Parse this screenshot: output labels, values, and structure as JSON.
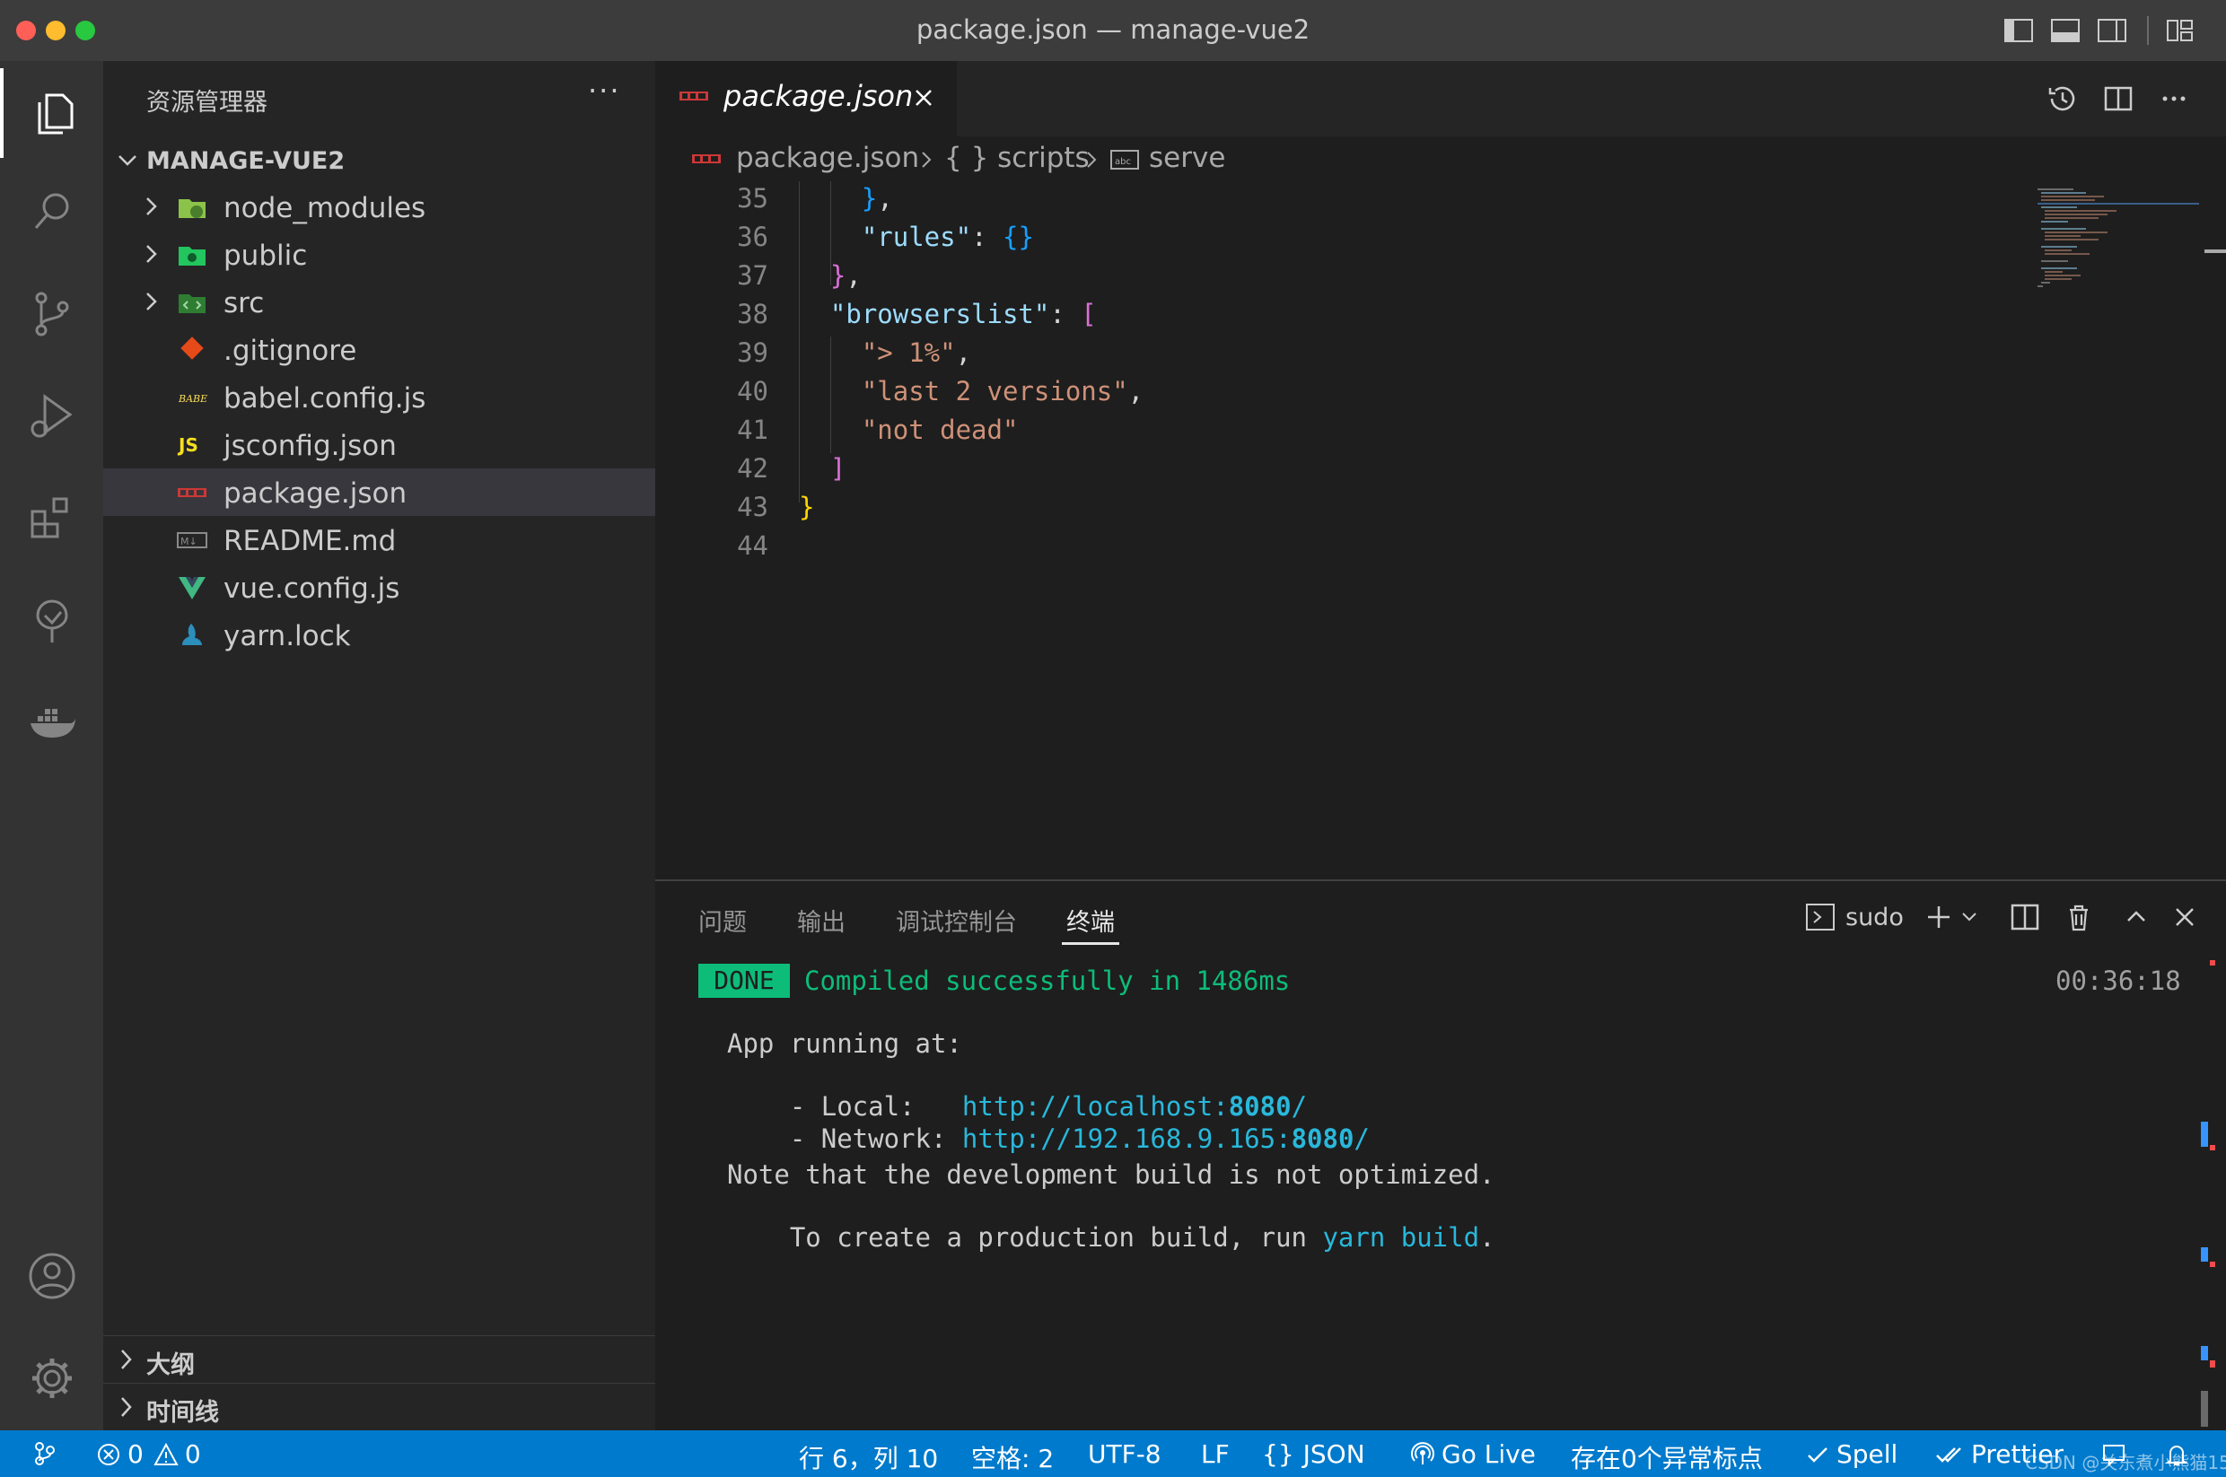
{
  "window": {
    "title": "package.json — manage-vue2"
  },
  "sidebar": {
    "title": "资源管理器",
    "more": "···",
    "folder": "MANAGE-VUE2",
    "items": [
      {
        "label": "node_modules",
        "icon": "node-modules-folder-icon",
        "type": "folder"
      },
      {
        "label": "public",
        "icon": "public-folder-icon",
        "type": "folder"
      },
      {
        "label": "src",
        "icon": "src-folder-icon",
        "type": "folder"
      },
      {
        "label": ".gitignore",
        "icon": "git-icon",
        "type": "file"
      },
      {
        "label": "babel.config.js",
        "icon": "babel-icon",
        "type": "file"
      },
      {
        "label": "jsconfig.json",
        "icon": "js-icon",
        "type": "file"
      },
      {
        "label": "package.json",
        "icon": "npm-icon",
        "type": "file",
        "selected": true
      },
      {
        "label": "README.md",
        "icon": "markdown-icon",
        "type": "file"
      },
      {
        "label": "vue.config.js",
        "icon": "vue-icon",
        "type": "file"
      },
      {
        "label": "yarn.lock",
        "icon": "yarn-icon",
        "type": "file"
      }
    ],
    "sections": [
      {
        "label": "大纲"
      },
      {
        "label": "时间线"
      }
    ]
  },
  "editor": {
    "tab": {
      "label": "package.json",
      "icon_text": "npm"
    },
    "breadcrumb": {
      "file": "package.json",
      "scripts": "{ } scripts",
      "serve": "serve"
    },
    "lines": [
      {
        "n": "35",
        "tokens": [
          {
            "t": "    ",
            "c": "plain"
          },
          {
            "t": "}",
            "c": "brace2"
          },
          {
            "t": ",",
            "c": "plain"
          }
        ]
      },
      {
        "n": "36",
        "tokens": [
          {
            "t": "    ",
            "c": "plain"
          },
          {
            "t": "\"rules\"",
            "c": "key"
          },
          {
            "t": ": ",
            "c": "plain"
          },
          {
            "t": "{}",
            "c": "brace2"
          }
        ]
      },
      {
        "n": "37",
        "tokens": [
          {
            "t": "  ",
            "c": "plain"
          },
          {
            "t": "}",
            "c": "brace1"
          },
          {
            "t": ",",
            "c": "plain"
          }
        ]
      },
      {
        "n": "38",
        "tokens": [
          {
            "t": "  ",
            "c": "plain"
          },
          {
            "t": "\"browserslist\"",
            "c": "key"
          },
          {
            "t": ": ",
            "c": "plain"
          },
          {
            "t": "[",
            "c": "brace1"
          }
        ]
      },
      {
        "n": "39",
        "tokens": [
          {
            "t": "    ",
            "c": "plain"
          },
          {
            "t": "\"> 1%\"",
            "c": "str"
          },
          {
            "t": ",",
            "c": "plain"
          }
        ]
      },
      {
        "n": "40",
        "tokens": [
          {
            "t": "    ",
            "c": "plain"
          },
          {
            "t": "\"last 2 versions\"",
            "c": "str"
          },
          {
            "t": ",",
            "c": "plain"
          }
        ]
      },
      {
        "n": "41",
        "tokens": [
          {
            "t": "    ",
            "c": "plain"
          },
          {
            "t": "\"not dead\"",
            "c": "str"
          }
        ]
      },
      {
        "n": "42",
        "tokens": [
          {
            "t": "  ",
            "c": "plain"
          },
          {
            "t": "]",
            "c": "brace1"
          }
        ]
      },
      {
        "n": "43",
        "tokens": [
          {
            "t": "}",
            "c": "brace0"
          }
        ]
      },
      {
        "n": "44",
        "tokens": []
      }
    ]
  },
  "panel": {
    "tabs": [
      "问题",
      "输出",
      "调试控制台",
      "终端"
    ],
    "active_tab": "终端",
    "terminal_name": "sudo",
    "terminal": {
      "done": "DONE",
      "compiled": "Compiled successfully in 1486ms",
      "time": "00:36:18",
      "app_running": "App running at:",
      "local_label": "- Local:   ",
      "local_url_prefix": "http://localhost:",
      "local_port": "8080",
      "local_url_suffix": "/",
      "network_label": "- Network: ",
      "network_url_prefix": "http://192.168.9.165:",
      "network_port": "8080",
      "network_url_suffix": "/",
      "note1": "Note that the development build is not optimized.",
      "note2_prefix": "To create a production build, run ",
      "note2_cmd": "yarn build",
      "note2_suffix": "."
    }
  },
  "statusbar": {
    "errors": "0",
    "warnings": "0",
    "position": "行 6，列 10",
    "spaces": "空格: 2",
    "encoding": "UTF-8",
    "eol": "LF",
    "language": "JSON",
    "golive": "Go Live",
    "anomaly": "存在0个异常标点",
    "spell": "Spell",
    "prettier": "Prettier",
    "watermark": "CSDN @关东煮小熊猫15"
  },
  "colors": {
    "accent": "#007acc",
    "key": "#9cdcfe",
    "string": "#ce9178",
    "brace0": "#ffd700",
    "brace1": "#da70d6",
    "brace2": "#179fff",
    "done": "#0dbc79",
    "url": "#29b8db"
  }
}
